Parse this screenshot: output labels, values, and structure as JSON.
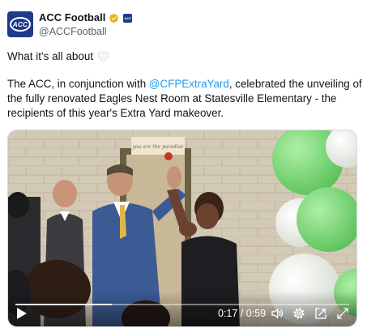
{
  "tweet": {
    "author": {
      "display_name": "ACC Football",
      "handle": "@ACCFootball",
      "avatar_text": "ACC",
      "affiliation_badge": "ACC",
      "verified_badge": "gold-check-icon"
    },
    "line1": "What it's all about",
    "line1_emoji": "white-heart-icon",
    "body_pre": "The ACC, in conjunction with ",
    "body_link": "@CFPExtraYard",
    "body_post": ", celebrated the unveiling of the fully renovated Eagles Nest Room at Statesville Elementary - the recipients of this year's Extra Yard makeover."
  },
  "video": {
    "current_time": "0:17",
    "separator": " / ",
    "duration": "0:59",
    "progress": 0.288,
    "sign_text": "you are the paradise",
    "controls": [
      "play-icon",
      "volume-icon",
      "settings-icon",
      "picture-in-picture-icon",
      "fullscreen-icon"
    ]
  },
  "colors": {
    "link": "#1d9bf0",
    "handle": "#536471",
    "brand": "#1e3a8a",
    "balloon_green": "#7ed67a"
  }
}
